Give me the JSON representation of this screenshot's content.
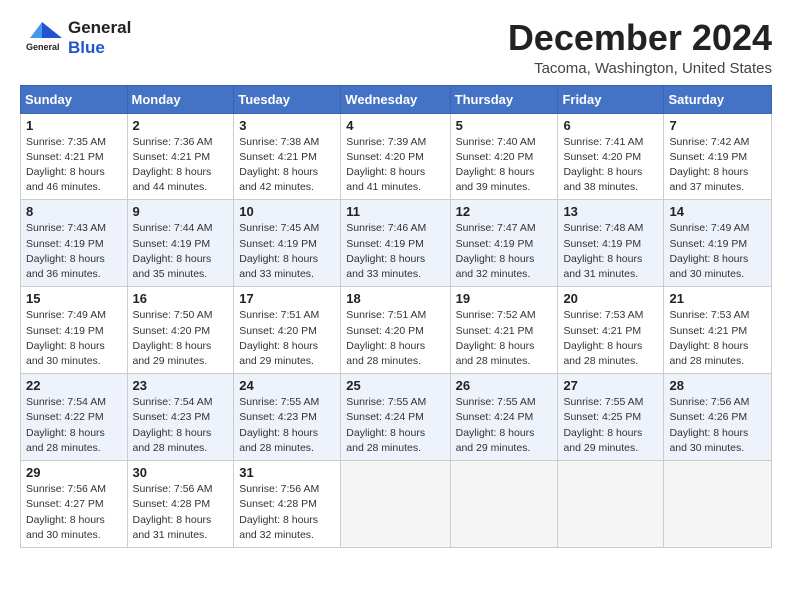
{
  "header": {
    "logo_general": "General",
    "logo_blue": "Blue",
    "month_title": "December 2024",
    "location": "Tacoma, Washington, United States"
  },
  "weekdays": [
    "Sunday",
    "Monday",
    "Tuesday",
    "Wednesday",
    "Thursday",
    "Friday",
    "Saturday"
  ],
  "weeks": [
    [
      {
        "day": "1",
        "sunrise": "Sunrise: 7:35 AM",
        "sunset": "Sunset: 4:21 PM",
        "daylight": "Daylight: 8 hours and 46 minutes."
      },
      {
        "day": "2",
        "sunrise": "Sunrise: 7:36 AM",
        "sunset": "Sunset: 4:21 PM",
        "daylight": "Daylight: 8 hours and 44 minutes."
      },
      {
        "day": "3",
        "sunrise": "Sunrise: 7:38 AM",
        "sunset": "Sunset: 4:21 PM",
        "daylight": "Daylight: 8 hours and 42 minutes."
      },
      {
        "day": "4",
        "sunrise": "Sunrise: 7:39 AM",
        "sunset": "Sunset: 4:20 PM",
        "daylight": "Daylight: 8 hours and 41 minutes."
      },
      {
        "day": "5",
        "sunrise": "Sunrise: 7:40 AM",
        "sunset": "Sunset: 4:20 PM",
        "daylight": "Daylight: 8 hours and 39 minutes."
      },
      {
        "day": "6",
        "sunrise": "Sunrise: 7:41 AM",
        "sunset": "Sunset: 4:20 PM",
        "daylight": "Daylight: 8 hours and 38 minutes."
      },
      {
        "day": "7",
        "sunrise": "Sunrise: 7:42 AM",
        "sunset": "Sunset: 4:19 PM",
        "daylight": "Daylight: 8 hours and 37 minutes."
      }
    ],
    [
      {
        "day": "8",
        "sunrise": "Sunrise: 7:43 AM",
        "sunset": "Sunset: 4:19 PM",
        "daylight": "Daylight: 8 hours and 36 minutes."
      },
      {
        "day": "9",
        "sunrise": "Sunrise: 7:44 AM",
        "sunset": "Sunset: 4:19 PM",
        "daylight": "Daylight: 8 hours and 35 minutes."
      },
      {
        "day": "10",
        "sunrise": "Sunrise: 7:45 AM",
        "sunset": "Sunset: 4:19 PM",
        "daylight": "Daylight: 8 hours and 33 minutes."
      },
      {
        "day": "11",
        "sunrise": "Sunrise: 7:46 AM",
        "sunset": "Sunset: 4:19 PM",
        "daylight": "Daylight: 8 hours and 33 minutes."
      },
      {
        "day": "12",
        "sunrise": "Sunrise: 7:47 AM",
        "sunset": "Sunset: 4:19 PM",
        "daylight": "Daylight: 8 hours and 32 minutes."
      },
      {
        "day": "13",
        "sunrise": "Sunrise: 7:48 AM",
        "sunset": "Sunset: 4:19 PM",
        "daylight": "Daylight: 8 hours and 31 minutes."
      },
      {
        "day": "14",
        "sunrise": "Sunrise: 7:49 AM",
        "sunset": "Sunset: 4:19 PM",
        "daylight": "Daylight: 8 hours and 30 minutes."
      }
    ],
    [
      {
        "day": "15",
        "sunrise": "Sunrise: 7:49 AM",
        "sunset": "Sunset: 4:19 PM",
        "daylight": "Daylight: 8 hours and 30 minutes."
      },
      {
        "day": "16",
        "sunrise": "Sunrise: 7:50 AM",
        "sunset": "Sunset: 4:20 PM",
        "daylight": "Daylight: 8 hours and 29 minutes."
      },
      {
        "day": "17",
        "sunrise": "Sunrise: 7:51 AM",
        "sunset": "Sunset: 4:20 PM",
        "daylight": "Daylight: 8 hours and 29 minutes."
      },
      {
        "day": "18",
        "sunrise": "Sunrise: 7:51 AM",
        "sunset": "Sunset: 4:20 PM",
        "daylight": "Daylight: 8 hours and 28 minutes."
      },
      {
        "day": "19",
        "sunrise": "Sunrise: 7:52 AM",
        "sunset": "Sunset: 4:21 PM",
        "daylight": "Daylight: 8 hours and 28 minutes."
      },
      {
        "day": "20",
        "sunrise": "Sunrise: 7:53 AM",
        "sunset": "Sunset: 4:21 PM",
        "daylight": "Daylight: 8 hours and 28 minutes."
      },
      {
        "day": "21",
        "sunrise": "Sunrise: 7:53 AM",
        "sunset": "Sunset: 4:21 PM",
        "daylight": "Daylight: 8 hours and 28 minutes."
      }
    ],
    [
      {
        "day": "22",
        "sunrise": "Sunrise: 7:54 AM",
        "sunset": "Sunset: 4:22 PM",
        "daylight": "Daylight: 8 hours and 28 minutes."
      },
      {
        "day": "23",
        "sunrise": "Sunrise: 7:54 AM",
        "sunset": "Sunset: 4:23 PM",
        "daylight": "Daylight: 8 hours and 28 minutes."
      },
      {
        "day": "24",
        "sunrise": "Sunrise: 7:55 AM",
        "sunset": "Sunset: 4:23 PM",
        "daylight": "Daylight: 8 hours and 28 minutes."
      },
      {
        "day": "25",
        "sunrise": "Sunrise: 7:55 AM",
        "sunset": "Sunset: 4:24 PM",
        "daylight": "Daylight: 8 hours and 28 minutes."
      },
      {
        "day": "26",
        "sunrise": "Sunrise: 7:55 AM",
        "sunset": "Sunset: 4:24 PM",
        "daylight": "Daylight: 8 hours and 29 minutes."
      },
      {
        "day": "27",
        "sunrise": "Sunrise: 7:55 AM",
        "sunset": "Sunset: 4:25 PM",
        "daylight": "Daylight: 8 hours and 29 minutes."
      },
      {
        "day": "28",
        "sunrise": "Sunrise: 7:56 AM",
        "sunset": "Sunset: 4:26 PM",
        "daylight": "Daylight: 8 hours and 30 minutes."
      }
    ],
    [
      {
        "day": "29",
        "sunrise": "Sunrise: 7:56 AM",
        "sunset": "Sunset: 4:27 PM",
        "daylight": "Daylight: 8 hours and 30 minutes."
      },
      {
        "day": "30",
        "sunrise": "Sunrise: 7:56 AM",
        "sunset": "Sunset: 4:28 PM",
        "daylight": "Daylight: 8 hours and 31 minutes."
      },
      {
        "day": "31",
        "sunrise": "Sunrise: 7:56 AM",
        "sunset": "Sunset: 4:28 PM",
        "daylight": "Daylight: 8 hours and 32 minutes."
      },
      null,
      null,
      null,
      null
    ]
  ]
}
